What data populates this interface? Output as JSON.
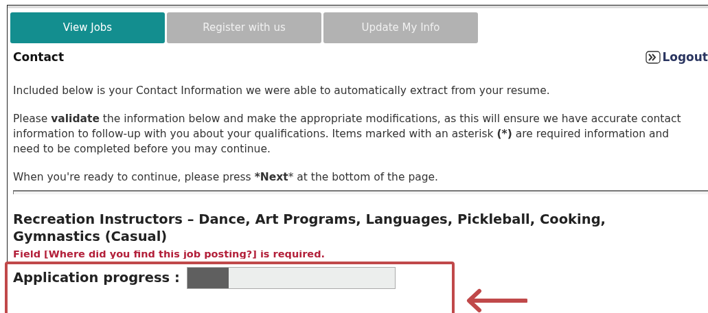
{
  "tabs": [
    {
      "label": "View Jobs",
      "selected": true
    },
    {
      "label": "Register with us",
      "selected": false
    },
    {
      "label": "Update My Info",
      "selected": false
    }
  ],
  "section_title": "Contact",
  "logout": "Logout",
  "paragraphs": [
    "Included below is your Contact Information we were able to automatically extract from your resume.",
    "Please **validate** the information below and make the appropriate modifications, as this will ensure we have accurate contact information to follow-up with you about your qualifications. Items marked with an asterisk **(*)** are required information and need to be completed before you may continue.",
    "When you're ready to continue, please press ***Next*** at the bottom of the page."
  ],
  "job_title": "Recreation Instructors – Dance, Art Programs, Languages, Pickleball, Cooking, Gymnastics (Casual)",
  "error": "Field [Where did you find this job posting?] is required.",
  "progress": {
    "label": "Application progress :",
    "level": 0.2
  }
}
